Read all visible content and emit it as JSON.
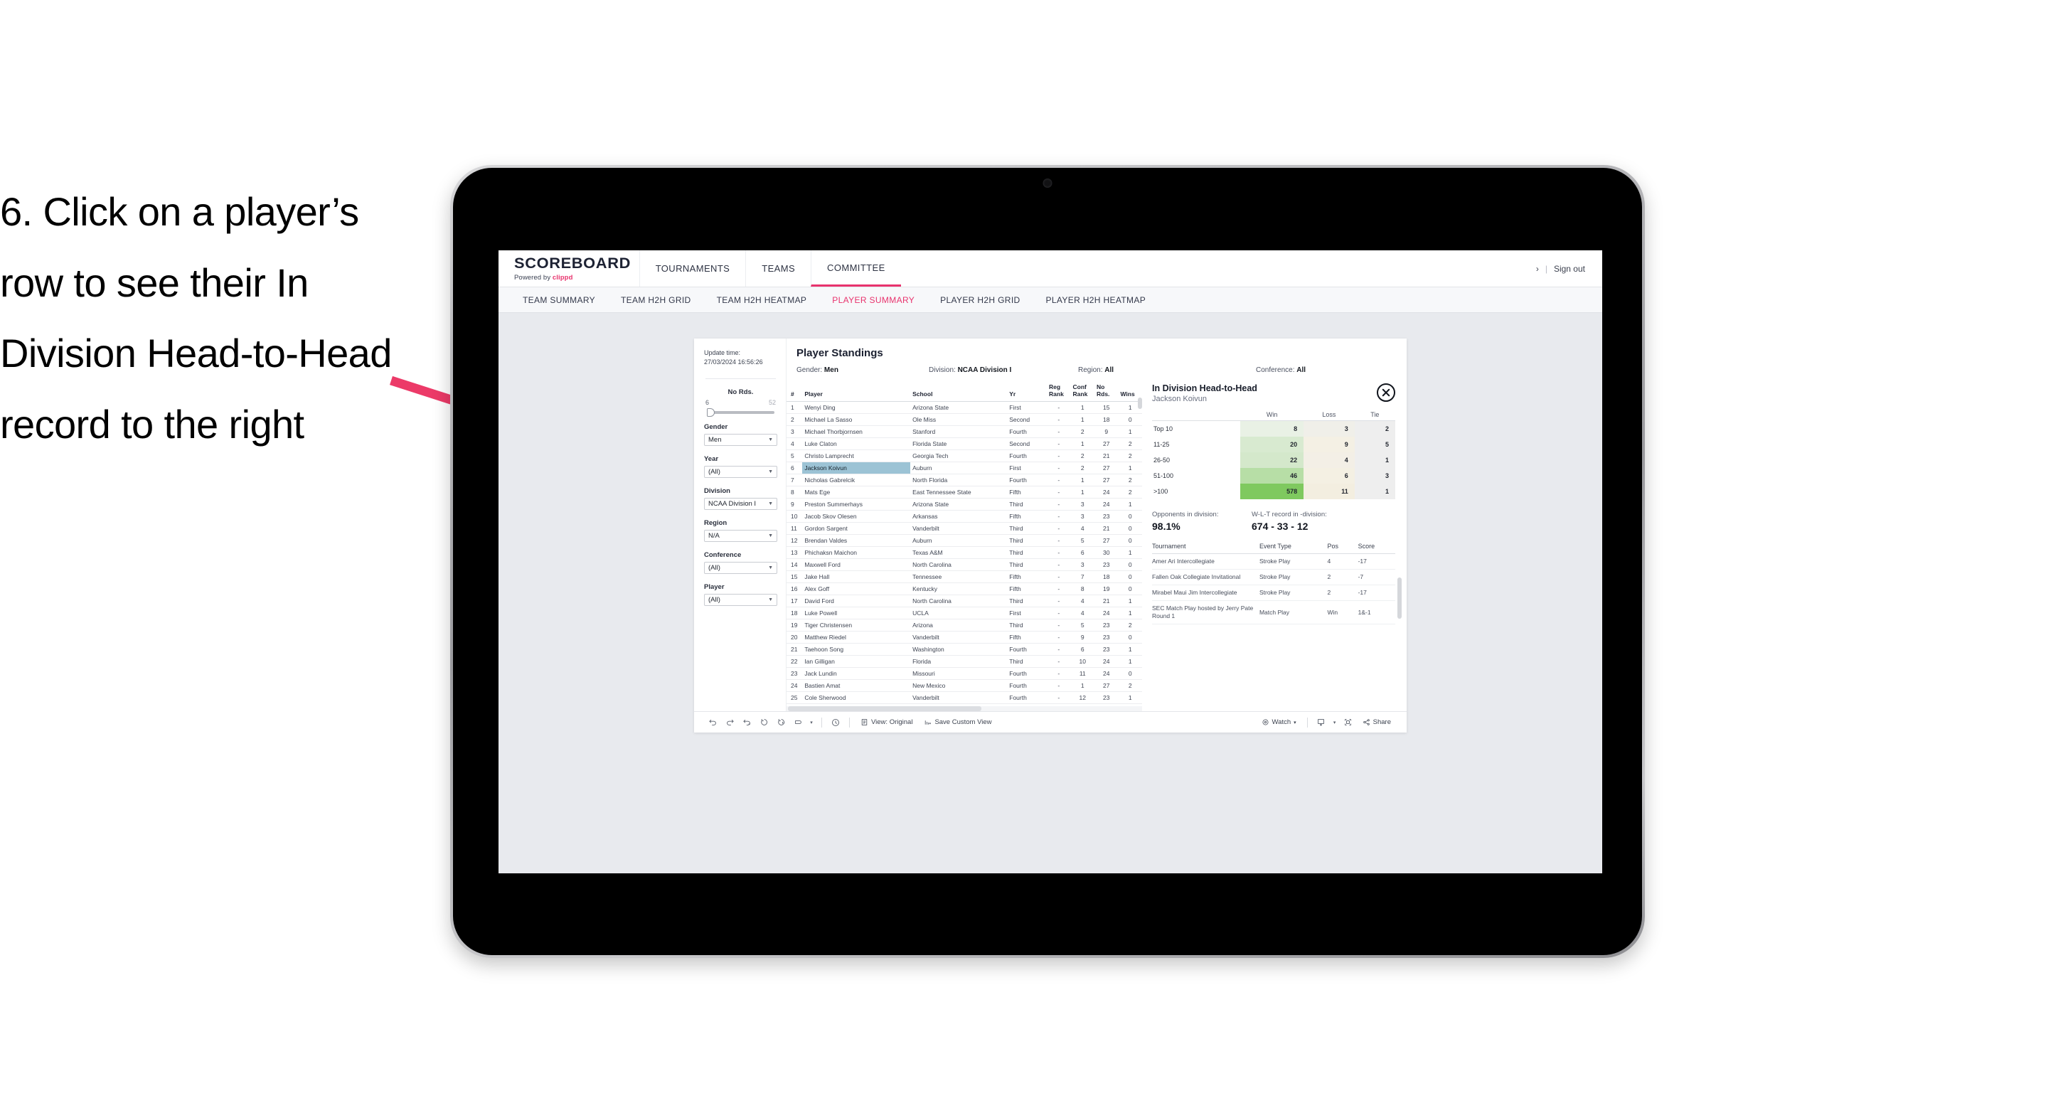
{
  "annotation": {
    "text": "6. Click on a player’s row to see their In Division Head-to-Head record to the right",
    "arrow_color": "#ec3a68"
  },
  "header": {
    "brand_title": "SCOREBOARD",
    "brand_powered": "Powered by",
    "brand_name": "clippd",
    "nav": [
      {
        "label": "TOURNAMENTS",
        "active": false
      },
      {
        "label": "TEAMS",
        "active": false
      },
      {
        "label": "COMMITTEE",
        "active": true
      }
    ],
    "chevron": "›",
    "separator": "|",
    "sign_out": "Sign out"
  },
  "sub_nav": [
    {
      "label": "TEAM SUMMARY",
      "active": false
    },
    {
      "label": "TEAM H2H GRID",
      "active": false
    },
    {
      "label": "TEAM H2H HEATMAP",
      "active": false
    },
    {
      "label": "PLAYER SUMMARY",
      "active": true
    },
    {
      "label": "PLAYER H2H GRID",
      "active": false
    },
    {
      "label": "PLAYER H2H HEATMAP",
      "active": false
    }
  ],
  "filters": {
    "update_label": "Update time:",
    "update_value": "27/03/2024 16:56:26",
    "slider": {
      "label": "No Rds.",
      "min": "6",
      "max": "52"
    },
    "selects": [
      {
        "label": "Gender",
        "value": "Men"
      },
      {
        "label": "Year",
        "value": "(All)"
      },
      {
        "label": "Division",
        "value": "NCAA Division I"
      },
      {
        "label": "Region",
        "value": "N/A"
      },
      {
        "label": "Conference",
        "value": "(All)"
      },
      {
        "label": "Player",
        "value": "(All)"
      }
    ]
  },
  "standings": {
    "title": "Player Standings",
    "meta": [
      {
        "label": "Gender:",
        "value": "Men"
      },
      {
        "label": "Division:",
        "value": "NCAA Division I"
      },
      {
        "label": "Region:",
        "value": "All"
      },
      {
        "label": "Conference:",
        "value": "All"
      }
    ],
    "columns": [
      "#",
      "Player",
      "School",
      "Yr",
      "Reg Rank",
      "Conf Rank",
      "No Rds.",
      "Wins"
    ],
    "rows": [
      {
        "num": "1",
        "player": "Wenyi Ding",
        "school": "Arizona State",
        "yr": "First",
        "reg": "-",
        "conf": "1",
        "rds": "15",
        "wins": "1",
        "selected": false
      },
      {
        "num": "2",
        "player": "Michael La Sasso",
        "school": "Ole Miss",
        "yr": "Second",
        "reg": "-",
        "conf": "1",
        "rds": "18",
        "wins": "0",
        "selected": false
      },
      {
        "num": "3",
        "player": "Michael Thorbjornsen",
        "school": "Stanford",
        "yr": "Fourth",
        "reg": "-",
        "conf": "2",
        "rds": "9",
        "wins": "1",
        "selected": false
      },
      {
        "num": "4",
        "player": "Luke Claton",
        "school": "Florida State",
        "yr": "Second",
        "reg": "-",
        "conf": "1",
        "rds": "27",
        "wins": "2",
        "selected": false
      },
      {
        "num": "5",
        "player": "Christo Lamprecht",
        "school": "Georgia Tech",
        "yr": "Fourth",
        "reg": "-",
        "conf": "2",
        "rds": "21",
        "wins": "2",
        "selected": false
      },
      {
        "num": "6",
        "player": "Jackson Koivun",
        "school": "Auburn",
        "yr": "First",
        "reg": "-",
        "conf": "2",
        "rds": "27",
        "wins": "1",
        "selected": true
      },
      {
        "num": "7",
        "player": "Nicholas Gabrelcik",
        "school": "North Florida",
        "yr": "Fourth",
        "reg": "-",
        "conf": "1",
        "rds": "27",
        "wins": "2",
        "selected": false
      },
      {
        "num": "8",
        "player": "Mats Ege",
        "school": "East Tennessee State",
        "yr": "Fifth",
        "reg": "-",
        "conf": "1",
        "rds": "24",
        "wins": "2",
        "selected": false
      },
      {
        "num": "9",
        "player": "Preston Summerhays",
        "school": "Arizona State",
        "yr": "Third",
        "reg": "-",
        "conf": "3",
        "rds": "24",
        "wins": "1",
        "selected": false
      },
      {
        "num": "10",
        "player": "Jacob Skov Olesen",
        "school": "Arkansas",
        "yr": "Fifth",
        "reg": "-",
        "conf": "3",
        "rds": "23",
        "wins": "0",
        "selected": false
      },
      {
        "num": "11",
        "player": "Gordon Sargent",
        "school": "Vanderbilt",
        "yr": "Third",
        "reg": "-",
        "conf": "4",
        "rds": "21",
        "wins": "0",
        "selected": false
      },
      {
        "num": "12",
        "player": "Brendan Valdes",
        "school": "Auburn",
        "yr": "Third",
        "reg": "-",
        "conf": "5",
        "rds": "27",
        "wins": "0",
        "selected": false
      },
      {
        "num": "13",
        "player": "Phichaksn Maichon",
        "school": "Texas A&M",
        "yr": "Third",
        "reg": "-",
        "conf": "6",
        "rds": "30",
        "wins": "1",
        "selected": false
      },
      {
        "num": "14",
        "player": "Maxwell Ford",
        "school": "North Carolina",
        "yr": "Third",
        "reg": "-",
        "conf": "3",
        "rds": "23",
        "wins": "0",
        "selected": false
      },
      {
        "num": "15",
        "player": "Jake Hall",
        "school": "Tennessee",
        "yr": "Fifth",
        "reg": "-",
        "conf": "7",
        "rds": "18",
        "wins": "0",
        "selected": false
      },
      {
        "num": "16",
        "player": "Alex Goff",
        "school": "Kentucky",
        "yr": "Fifth",
        "reg": "-",
        "conf": "8",
        "rds": "19",
        "wins": "0",
        "selected": false
      },
      {
        "num": "17",
        "player": "David Ford",
        "school": "North Carolina",
        "yr": "Third",
        "reg": "-",
        "conf": "4",
        "rds": "21",
        "wins": "1",
        "selected": false
      },
      {
        "num": "18",
        "player": "Luke Powell",
        "school": "UCLA",
        "yr": "First",
        "reg": "-",
        "conf": "4",
        "rds": "24",
        "wins": "1",
        "selected": false
      },
      {
        "num": "19",
        "player": "Tiger Christensen",
        "school": "Arizona",
        "yr": "Third",
        "reg": "-",
        "conf": "5",
        "rds": "23",
        "wins": "2",
        "selected": false
      },
      {
        "num": "20",
        "player": "Matthew Riedel",
        "school": "Vanderbilt",
        "yr": "Fifth",
        "reg": "-",
        "conf": "9",
        "rds": "23",
        "wins": "0",
        "selected": false
      },
      {
        "num": "21",
        "player": "Taehoon Song",
        "school": "Washington",
        "yr": "Fourth",
        "reg": "-",
        "conf": "6",
        "rds": "23",
        "wins": "1",
        "selected": false
      },
      {
        "num": "22",
        "player": "Ian Gilligan",
        "school": "Florida",
        "yr": "Third",
        "reg": "-",
        "conf": "10",
        "rds": "24",
        "wins": "1",
        "selected": false
      },
      {
        "num": "23",
        "player": "Jack Lundin",
        "school": "Missouri",
        "yr": "Fourth",
        "reg": "-",
        "conf": "11",
        "rds": "24",
        "wins": "0",
        "selected": false
      },
      {
        "num": "24",
        "player": "Bastien Amat",
        "school": "New Mexico",
        "yr": "Fourth",
        "reg": "-",
        "conf": "1",
        "rds": "27",
        "wins": "2",
        "selected": false
      },
      {
        "num": "25",
        "player": "Cole Sherwood",
        "school": "Vanderbilt",
        "yr": "Fourth",
        "reg": "-",
        "conf": "12",
        "rds": "23",
        "wins": "1",
        "selected": false
      }
    ]
  },
  "h2h": {
    "title": "In Division Head-to-Head",
    "player": "Jackson Koivun",
    "close_icon": "close-icon",
    "columns": [
      "",
      "Win",
      "Loss",
      "Tie"
    ],
    "rows": [
      {
        "bucket": "Top 10",
        "win": "8",
        "loss": "3",
        "tie": "2",
        "win_color": "#e9f1e5",
        "loss_color": "#f0efe9"
      },
      {
        "bucket": "11-25",
        "win": "20",
        "loss": "9",
        "tie": "5",
        "win_color": "#d8ead0",
        "loss_color": "#f4f0e4"
      },
      {
        "bucket": "26-50",
        "win": "22",
        "loss": "4",
        "tie": "1",
        "win_color": "#d4e8cb",
        "loss_color": "#f3efe6"
      },
      {
        "bucket": "51-100",
        "win": "46",
        "loss": "6",
        "tie": "3",
        "win_color": "#b7dea6",
        "loss_color": "#f4f0e3"
      },
      {
        "bucket": ">100",
        "win": "578",
        "loss": "11",
        "tie": "1",
        "win_color": "#7fc95f",
        "loss_color": "#f3eee0"
      }
    ],
    "tie_color": "#eeeeee",
    "stats": [
      {
        "label": "Opponents in division:",
        "value": "98.1%"
      },
      {
        "label": "W-L-T record in -division:",
        "value": "674 - 33 - 12"
      }
    ],
    "tournament_columns": [
      "Tournament",
      "Event Type",
      "Pos",
      "Score"
    ],
    "tournaments": [
      {
        "name": "Amer Ari Intercollegiate",
        "type": "Stroke Play",
        "pos": "4",
        "score": "-17"
      },
      {
        "name": "Fallen Oak Collegiate Invitational",
        "type": "Stroke Play",
        "pos": "2",
        "score": "-7"
      },
      {
        "name": "Mirabel Maui Jim Intercollegiate",
        "type": "Stroke Play",
        "pos": "2",
        "score": "-17"
      },
      {
        "name": "SEC Match Play hosted by Jerry Pate Round 1",
        "type": "Match Play",
        "pos": "Win",
        "score": "1&-1"
      }
    ]
  },
  "toolbar": {
    "icons": [
      "undo-icon",
      "redo-icon",
      "revert-icon",
      "refresh-icon",
      "pause-icon",
      "shape-icon",
      "clock-icon"
    ],
    "view_label": "View: Original",
    "save_label": "Save Custom View",
    "watch_label": "Watch",
    "share_label": "Share",
    "caret": "▾"
  }
}
